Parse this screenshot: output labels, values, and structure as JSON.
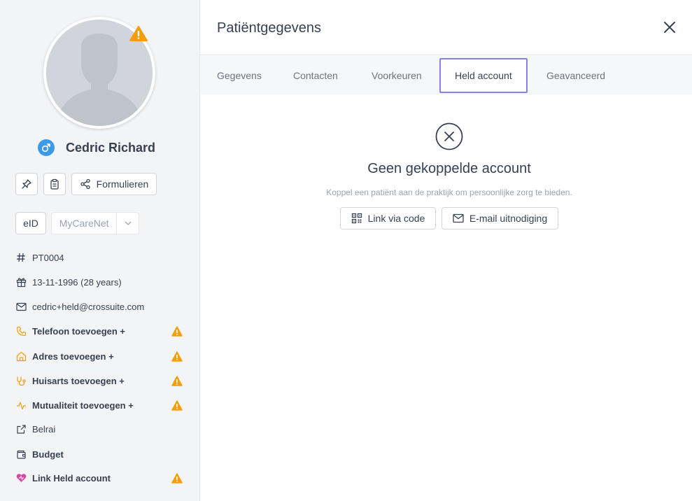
{
  "patient": {
    "name": "Cedric Richard",
    "gender_icon": "male-icon"
  },
  "sidebar": {
    "buttons": {
      "forms_label": "Formulieren",
      "eid_label": "eID",
      "mycarenet_label": "MyCareNet"
    },
    "info": [
      {
        "icon": "hash-icon",
        "text": "PT0004",
        "bold": false,
        "warning": false
      },
      {
        "icon": "gift-icon",
        "text": "13-11-1996 (28 years)",
        "bold": false,
        "warning": false
      },
      {
        "icon": "mail-icon",
        "text": "cedric+held@crossuite.com",
        "bold": false,
        "warning": false
      },
      {
        "icon": "phone-icon",
        "text": "Telefoon toevoegen +",
        "bold": true,
        "warning": true
      },
      {
        "icon": "home-icon",
        "text": "Adres toevoegen +",
        "bold": true,
        "warning": true
      },
      {
        "icon": "stethoscope-icon",
        "text": "Huisarts toevoegen +",
        "bold": true,
        "warning": true
      },
      {
        "icon": "activity-icon",
        "text": "Mutualiteit toevoegen +",
        "bold": true,
        "warning": true
      },
      {
        "icon": "external-link-icon",
        "text": "Belrai",
        "bold": false,
        "warning": false
      },
      {
        "icon": "wallet-icon",
        "text": "Budget",
        "bold": true,
        "warning": false
      },
      {
        "icon": "heart-icon",
        "text": "Link Held account",
        "bold": true,
        "warning": true
      }
    ]
  },
  "main": {
    "title": "Patiëntgegevens",
    "tabs": [
      {
        "label": "Gegevens",
        "active": false
      },
      {
        "label": "Contacten",
        "active": false
      },
      {
        "label": "Voorkeuren",
        "active": false
      },
      {
        "label": "Held account",
        "active": true
      },
      {
        "label": "Geavanceerd",
        "active": false
      }
    ],
    "empty": {
      "title": "Geen gekoppelde account",
      "subtitle": "Koppel een patiënt aan de praktijk om persoonlijke zorg te bieden.",
      "link_code_label": "Link via code",
      "email_invite_label": "E-mail uitnodiging"
    }
  },
  "colors": {
    "warning": "#f59e0b",
    "accent_orange": "#f59e0b",
    "gender_blue": "#3b9ae8",
    "active_tab_border": "#8b7ee8",
    "heart_pink": "#d946a8"
  }
}
